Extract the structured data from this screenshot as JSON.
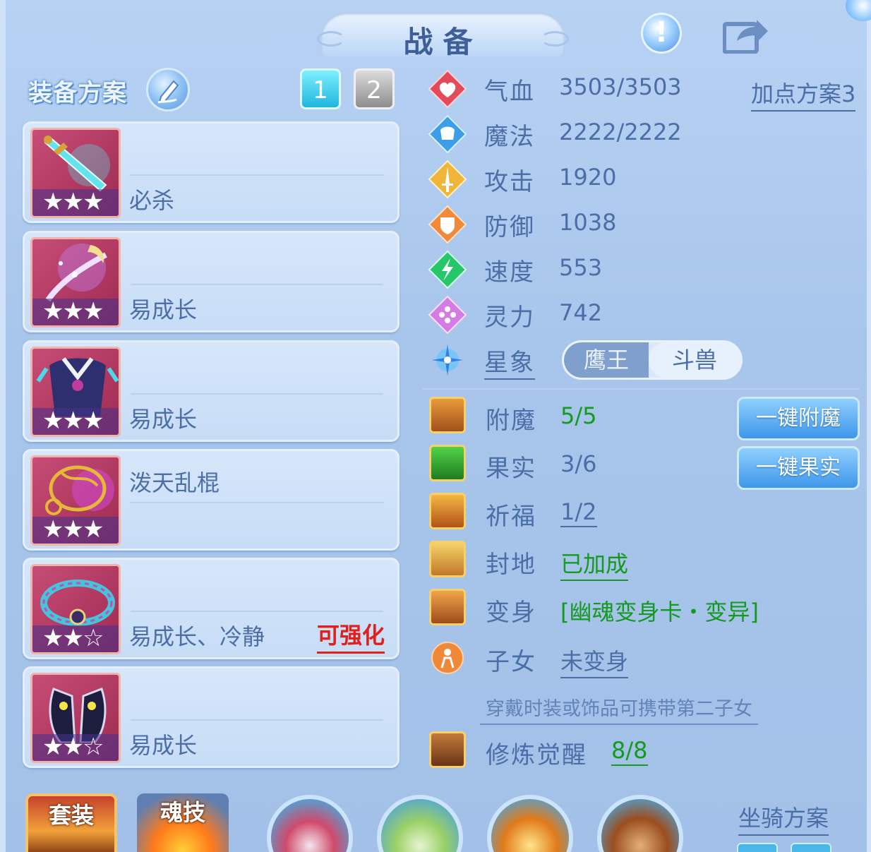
{
  "header": {
    "title": "战备"
  },
  "equip_plan": {
    "label": "装备方案",
    "pages": [
      "1",
      "2"
    ]
  },
  "equipment": [
    {
      "stars": "★★★",
      "effect": "必杀",
      "effect_row": "bottom",
      "tag": ""
    },
    {
      "stars": "★★★",
      "effect": "易成长",
      "effect_row": "bottom",
      "tag": ""
    },
    {
      "stars": "★★★",
      "effect": "易成长",
      "effect_row": "bottom",
      "tag": ""
    },
    {
      "stars": "★★★",
      "effect": "泼天乱棍",
      "effect_row": "top",
      "tag": ""
    },
    {
      "stars": "★★☆",
      "effect": "易成长、冷静",
      "effect_row": "bottom",
      "tag": "可强化"
    },
    {
      "stars": "★★☆",
      "effect": "易成长",
      "effect_row": "bottom",
      "tag": ""
    }
  ],
  "stats": {
    "add_point_plan": "加点方案3",
    "rows": [
      {
        "name": "气血",
        "value": "3503/3503",
        "icon": "heart-icon"
      },
      {
        "name": "魔法",
        "value": "2222/2222",
        "icon": "mana-icon"
      },
      {
        "name": "攻击",
        "value": "1920",
        "icon": "sword-icon"
      },
      {
        "name": "防御",
        "value": "1038",
        "icon": "shield-icon"
      },
      {
        "name": "速度",
        "value": "553",
        "icon": "lightning-icon"
      },
      {
        "name": "灵力",
        "value": "742",
        "icon": "spirit-icon"
      }
    ],
    "constellation": {
      "name": "星象",
      "options": [
        "鹰王",
        "斗兽"
      ],
      "selected": "斗兽"
    }
  },
  "enhancements": {
    "enchant": {
      "name": "附魔",
      "value": "5/5",
      "button": "一键附魔"
    },
    "fruit": {
      "name": "果实",
      "value": "3/6",
      "button": "一键果实"
    },
    "blessing": {
      "name": "祈福",
      "value": "1/2"
    },
    "territory": {
      "name": "封地",
      "value": "已加成"
    },
    "transform": {
      "name": "变身",
      "value": "[幽魂变身卡・变异]"
    },
    "child": {
      "name": "子女",
      "value": "未变身",
      "hint": "穿戴时装或饰品可携带第二子女"
    },
    "cultivation": {
      "name": "修炼觉醒",
      "value": "8/8"
    }
  },
  "bottom": {
    "tabs": [
      "套装",
      "魂技"
    ],
    "mount_plan": "坐骑方案"
  },
  "colors": {
    "accent": "#4c6ea6",
    "green": "#149a1f",
    "red": "#e0201a"
  }
}
